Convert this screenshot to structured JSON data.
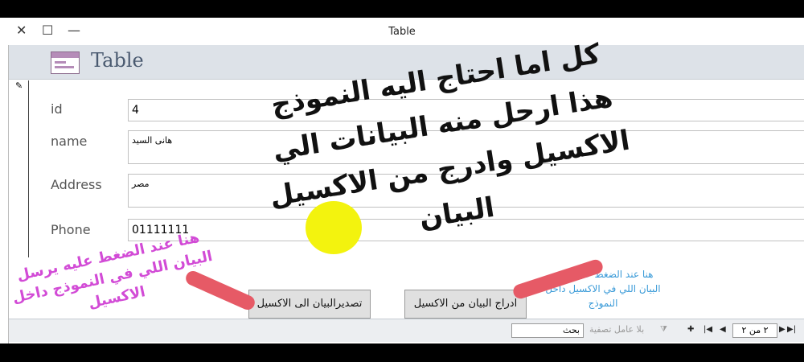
{
  "window": {
    "title": "Table",
    "controls": [
      "✕",
      "☐",
      "—"
    ]
  },
  "form": {
    "header_title": "Table",
    "fields": [
      {
        "label": "id",
        "value": "4"
      },
      {
        "label": "name",
        "value": "هانى السيد"
      },
      {
        "label": "Address",
        "value": "مصر"
      },
      {
        "label": "Phone",
        "value": "01111111"
      }
    ],
    "buttons": {
      "export": "تصديرالبيان الى الاكسيل",
      "import": "ادراج البيان من الاكسيل"
    }
  },
  "navbar": {
    "record_text": "٢ من ٢",
    "no_filter": "بلا عامل تصفية",
    "search": "بحث"
  },
  "annotations": {
    "main_lines": [
      "كل اما احتاج اليه النموذج",
      "هذا ارحل منه البيانات الي",
      "الاكسيل وادرج من الاكسيل",
      "البيان"
    ],
    "left_note_lines": [
      "هنا عند الضغط عليه يرسل",
      "البيان اللي في النموذج داخل",
      "الاكسيل"
    ],
    "right_note_lines": [
      "هنا عند الضغط عليه يدرج",
      "البيان اللي في الاكسيل داخل",
      "النموذج"
    ]
  },
  "colors": {
    "header_bg": "#dde2e8",
    "pink_note": "#d24bd6",
    "blue_note": "#3b9bd8",
    "stroke": "#e65a66",
    "highlight": "#f3f30e"
  }
}
